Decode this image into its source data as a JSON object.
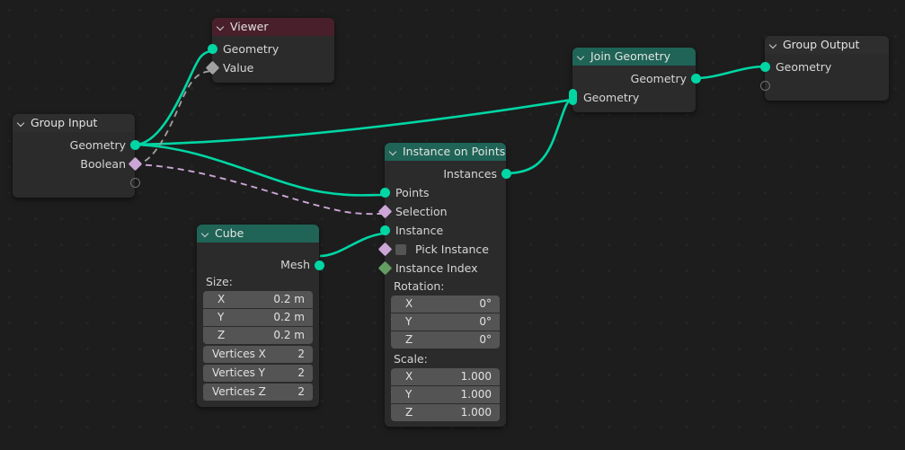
{
  "app": {
    "editor": "Blender Geometry Node Editor",
    "background_color": "#1d1d1d"
  },
  "socket_colors": {
    "geometry": "#00d6a4",
    "boolean": "#cca6d6",
    "integer": "#639d62",
    "vector": "#6363c7",
    "value_gray": "#a1a1a1"
  },
  "header_colors": {
    "geometry_node": "#1f6456",
    "viewer_node": "#4a1f2c",
    "group_io_node": "#2e2e2e"
  },
  "nodes": {
    "group_input": {
      "title": "Group Input",
      "outputs": [
        {
          "label": "Geometry",
          "socket": "geometry"
        },
        {
          "label": "Boolean",
          "socket": "boolean"
        },
        {
          "label": "",
          "socket": "empty"
        }
      ]
    },
    "viewer": {
      "title": "Viewer",
      "inputs": [
        {
          "label": "Geometry",
          "socket": "geometry"
        },
        {
          "label": "Value",
          "socket": "value_gray"
        }
      ]
    },
    "join_geometry": {
      "title": "Join Geometry",
      "outputs": [
        {
          "label": "Geometry",
          "socket": "geometry"
        }
      ],
      "inputs": [
        {
          "label": "Geometry",
          "socket": "geometry",
          "multi_input": true
        }
      ]
    },
    "group_output": {
      "title": "Group Output",
      "inputs": [
        {
          "label": "Geometry",
          "socket": "geometry"
        },
        {
          "label": "",
          "socket": "empty"
        }
      ]
    },
    "instance_on_points": {
      "title": "Instance on Points",
      "outputs": [
        {
          "label": "Instances",
          "socket": "geometry"
        }
      ],
      "inputs": [
        {
          "label": "Points",
          "socket": "geometry"
        },
        {
          "label": "Selection",
          "socket": "boolean"
        },
        {
          "label": "Instance",
          "socket": "geometry"
        },
        {
          "label": "Pick Instance",
          "socket": "boolean",
          "checkbox": true,
          "checked": false
        },
        {
          "label": "Instance Index",
          "socket": "integer"
        }
      ],
      "rotation": {
        "label": "Rotation:",
        "socket": "vector",
        "fields": [
          {
            "axis": "X",
            "value": "0°"
          },
          {
            "axis": "Y",
            "value": "0°"
          },
          {
            "axis": "Z",
            "value": "0°"
          }
        ]
      },
      "scale": {
        "label": "Scale:",
        "socket": "vector",
        "fields": [
          {
            "axis": "X",
            "value": "1.000"
          },
          {
            "axis": "Y",
            "value": "1.000"
          },
          {
            "axis": "Z",
            "value": "1.000"
          }
        ]
      }
    },
    "cube": {
      "title": "Cube",
      "outputs": [
        {
          "label": "Mesh",
          "socket": "geometry"
        }
      ],
      "size": {
        "label": "Size:",
        "socket": "vector",
        "fields": [
          {
            "axis": "X",
            "value": "0.2 m"
          },
          {
            "axis": "Y",
            "value": "0.2 m"
          },
          {
            "axis": "Z",
            "value": "0.2 m"
          }
        ]
      },
      "vertices": [
        {
          "label": "Vertices X",
          "value": "2",
          "socket": "integer"
        },
        {
          "label": "Vertices Y",
          "value": "2",
          "socket": "integer"
        },
        {
          "label": "Vertices Z",
          "value": "2",
          "socket": "integer"
        }
      ]
    }
  },
  "links": [
    {
      "from": "group_input.Geometry",
      "to": "viewer.Geometry",
      "type": "geometry"
    },
    {
      "from": "group_input.Geometry",
      "to": "join_geometry.Geometry",
      "type": "geometry"
    },
    {
      "from": "group_input.Geometry",
      "to": "instance_on_points.Points",
      "type": "geometry"
    },
    {
      "from": "group_input.Boolean",
      "to": "viewer.Value",
      "type": "value_gray"
    },
    {
      "from": "group_input.Boolean",
      "to": "instance_on_points.Selection",
      "type": "boolean"
    },
    {
      "from": "cube.Mesh",
      "to": "instance_on_points.Instance",
      "type": "geometry"
    },
    {
      "from": "instance_on_points.Instances",
      "to": "join_geometry.Geometry",
      "type": "geometry"
    },
    {
      "from": "join_geometry.Geometry",
      "to": "group_output.Geometry",
      "type": "geometry"
    }
  ]
}
